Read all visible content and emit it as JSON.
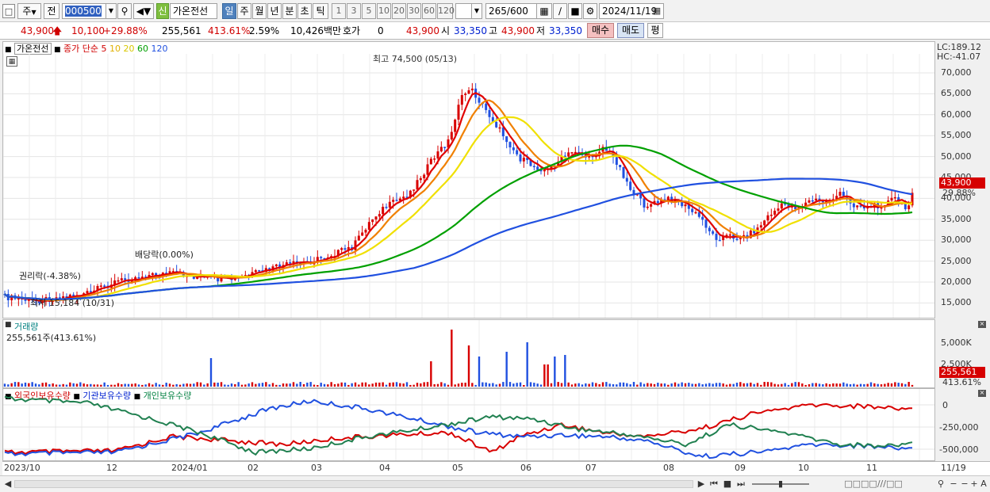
{
  "toolbar": {
    "type": "주",
    "prev": "전",
    "code": "000500",
    "badge": "신",
    "name": "가온전선",
    "periods": [
      "일",
      "주",
      "월",
      "년",
      "분",
      "초",
      "틱"
    ],
    "active_period": "일",
    "nums": [
      "1",
      "3",
      "5",
      "10",
      "20",
      "30",
      "60",
      "120"
    ],
    "count": "265",
    "count_total": "/600",
    "date": "2024/11/19"
  },
  "quote": {
    "price": "43,900",
    "change": "10,100",
    "rate": "+29.88%",
    "volume": "255,561",
    "vol_ratio": "413.61%",
    "turnover": "2.59%",
    "amount": "10,426백만",
    "hoga_label": "호가",
    "hoga_value": "0",
    "hoga_price": "43,900",
    "open_label": "시",
    "open": "33,350",
    "high_label": "고",
    "high": "43,900",
    "low_label": "저",
    "low": "33,350",
    "buy": "매수",
    "sell": "매도",
    "avg": "평"
  },
  "price_panel": {
    "name": "가온전선",
    "ma_label": "종가 단순",
    "ma_periods": [
      "5",
      "10",
      "20",
      "60",
      "120"
    ],
    "lc": "LC:189.12",
    "hc": "HC:-41.07",
    "high_annot": "최고 74,500 (05/13)",
    "low_annot": "최저 15,184 (10/31)",
    "rights_annot": "권리락(-4.38%)",
    "div_annot": "배당락(0.00%)",
    "y_ticks": [
      "70,000",
      "65,000",
      "60,000",
      "55,000",
      "50,000",
      "45,000",
      "40,000",
      "35,000",
      "30,000",
      "25,000",
      "20,000",
      "15,000"
    ],
    "last_price": "43,900",
    "last_rate": "29.88%"
  },
  "volume_panel": {
    "title": "거래량",
    "value": "255,561주(413.61%)",
    "y_ticks": [
      "5,000K",
      "2,500K"
    ],
    "last_value": "255,561",
    "last_rate": "413.61%"
  },
  "holding_panel": {
    "series": [
      "외국인보유수량",
      "기관보유수량",
      "개인보유수량"
    ],
    "y_ticks": [
      "0",
      "-250,000",
      "-500,000"
    ]
  },
  "x_axis": [
    "2023/10",
    "12",
    "2024/01",
    "02",
    "03",
    "04",
    "05",
    "06",
    "07",
    "08",
    "09",
    "10",
    "11",
    "11/19"
  ],
  "colors": {
    "ma5": "#e00000",
    "ma10": "#f08000",
    "ma20": "#f0e000",
    "ma60": "#00a000",
    "ma120": "#2050e0"
  }
}
